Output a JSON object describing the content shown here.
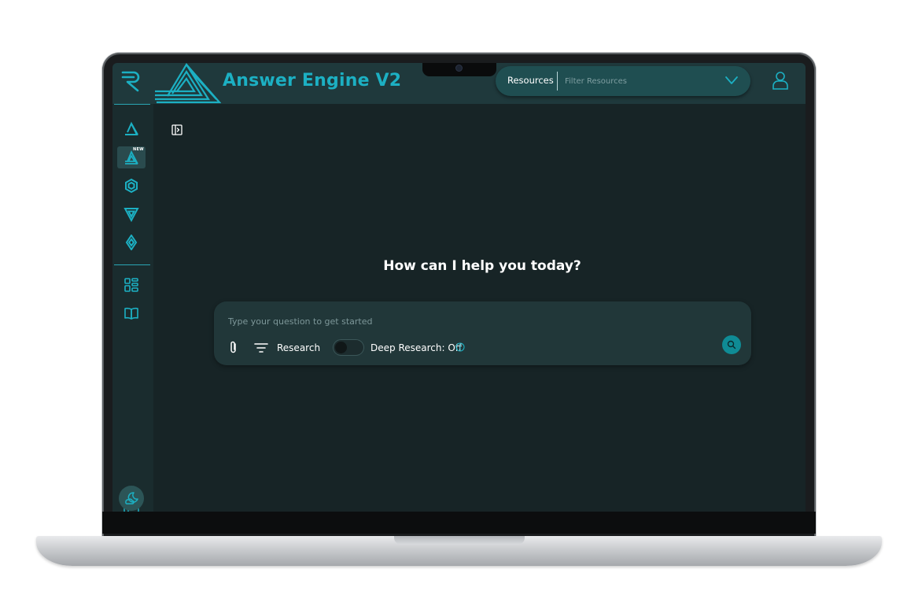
{
  "header": {
    "title": "Answer Engine V2",
    "resources_label": "Resources",
    "filter_placeholder": "Filter Resources"
  },
  "sidebar": {
    "new_badge": "NEW",
    "items": [
      {
        "icon": "answer-engine-icon"
      },
      {
        "icon": "answer-engine-v2-icon",
        "active": true,
        "badge": "NEW"
      },
      {
        "icon": "hexagon-icon"
      },
      {
        "icon": "triangle-icon"
      },
      {
        "icon": "diamond-icon"
      },
      {
        "icon": "dashboard-icon"
      },
      {
        "icon": "book-icon"
      }
    ]
  },
  "main": {
    "greeting": "How can I help you today?",
    "query_placeholder": "Type your question to get started",
    "research_label": "Research",
    "deep_research_label": "Deep Research: Off"
  },
  "colors": {
    "accent": "#1cb0c3",
    "background": "#172426",
    "header": "#1f393c",
    "card": "#213739"
  }
}
